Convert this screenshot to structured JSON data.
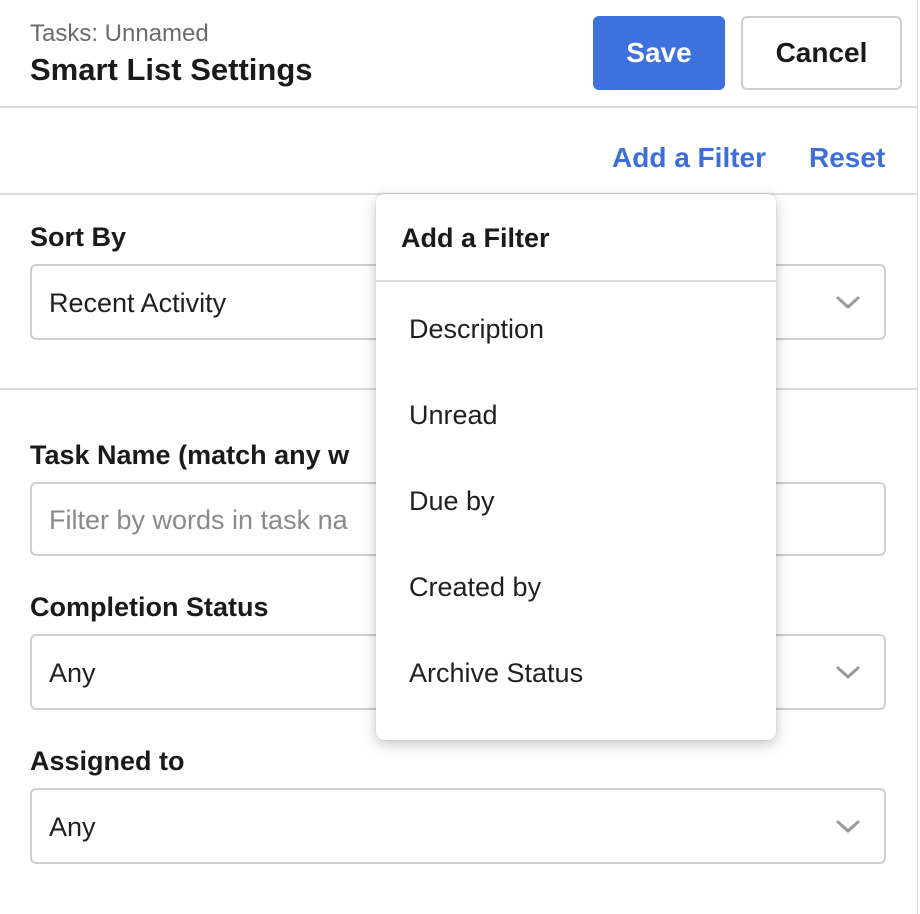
{
  "header": {
    "subtitle": "Tasks: Unnamed",
    "title": "Smart List Settings",
    "save_label": "Save",
    "cancel_label": "Cancel"
  },
  "filters_bar": {
    "add_filter_label": "Add a Filter",
    "reset_label": "Reset"
  },
  "sort_by": {
    "label": "Sort By",
    "value": "Recent Activity"
  },
  "task_name": {
    "label": "Task Name (match any w",
    "placeholder": "Filter by words in task na"
  },
  "completion_status": {
    "label": "Completion Status",
    "value": "Any"
  },
  "assigned_to": {
    "label": "Assigned to",
    "value": "Any"
  },
  "add_filter_menu": {
    "title": "Add a Filter",
    "items": [
      "Description",
      "Unread",
      "Due by",
      "Created by",
      "Archive Status"
    ]
  },
  "colors": {
    "accent": "#3d72de",
    "link": "#3c6fd8",
    "border": "#cfcfcf"
  },
  "icons": {
    "select_chevron": "chevron-down-icon"
  }
}
